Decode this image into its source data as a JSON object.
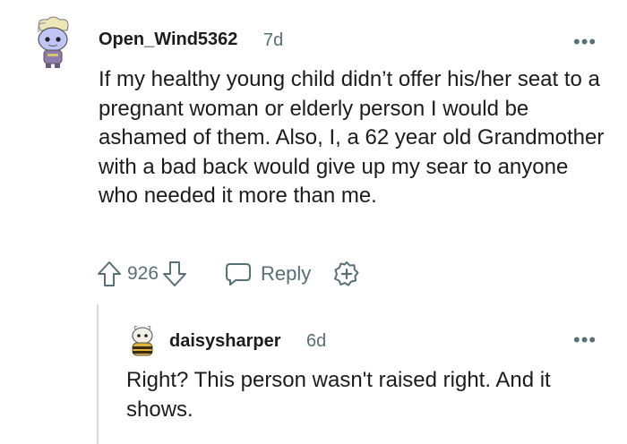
{
  "comment": {
    "username": "Open_Wind5362",
    "time": "7d",
    "more_label": "•••",
    "avatar_icon": "snoo-avatar-blue-icon",
    "body": "If my healthy young child didn’t offer his/her seat to a pregnant woman or elderly person I would be ashamed of them. Also, I, a 62 year old Grandmother with a bad back would give up my sear to anyone who needed it more than me.",
    "votes": "926",
    "reply_label": "Reply",
    "icons": {
      "upvote": "upvote-arrow-icon",
      "downvote": "downvote-arrow-icon",
      "reply": "speech-bubble-icon",
      "award": "award-plus-icon"
    }
  },
  "reply": {
    "username": "daisysharper",
    "time": "6d",
    "more_label": "•••",
    "avatar_icon": "snoo-avatar-bee-icon",
    "body": "Right? This person wasn't raised right. And it shows."
  },
  "colors": {
    "text": "#1c1c1c",
    "muted": "#576f76",
    "thread_line": "#d3dbe0"
  }
}
